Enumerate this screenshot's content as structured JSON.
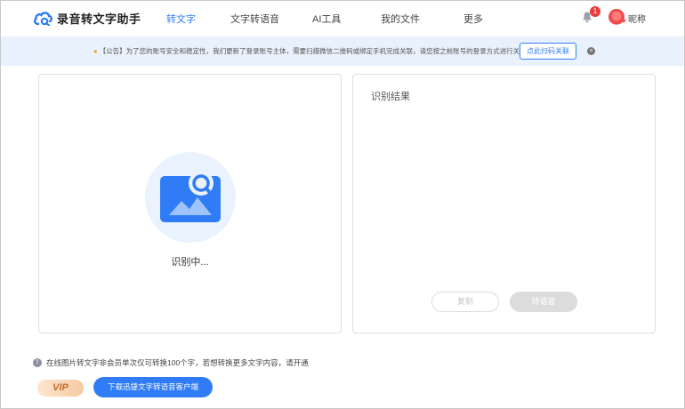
{
  "header": {
    "app_name": "录音转文字助手",
    "nav": [
      {
        "label": "转文字",
        "active": true
      },
      {
        "label": "文字转语音",
        "active": false
      },
      {
        "label": "AI工具",
        "active": false
      },
      {
        "label": "我的文件",
        "active": false
      },
      {
        "label": "更多",
        "active": false
      }
    ],
    "notification_count": "1",
    "nickname": "昵称"
  },
  "notice": {
    "text": "【公告】为了您的账号安全和稳定性，我们更新了登录账号主体，需要扫描微信二维码或绑定手机完成关联，请您按之前账号的登录方式进行关联。",
    "button_label": "点此扫码关联",
    "close_icon": "×"
  },
  "left_panel": {
    "status_text": "识别中..."
  },
  "right_panel": {
    "title": "识别结果",
    "copy_label": "复制",
    "to_voice_label": "转语音"
  },
  "footer": {
    "tip_icon": "!",
    "tip_text": "在线图片转文字非会员单次仅可转换100个字，若想转换更多文字内容，请开通",
    "vip_label": "VIP",
    "download_label": "下载迅捷文字转语音客户端"
  },
  "colors": {
    "accent": "#2f7cf6",
    "notice_bg": "#e9f1fc",
    "badge": "#e93c3c"
  }
}
